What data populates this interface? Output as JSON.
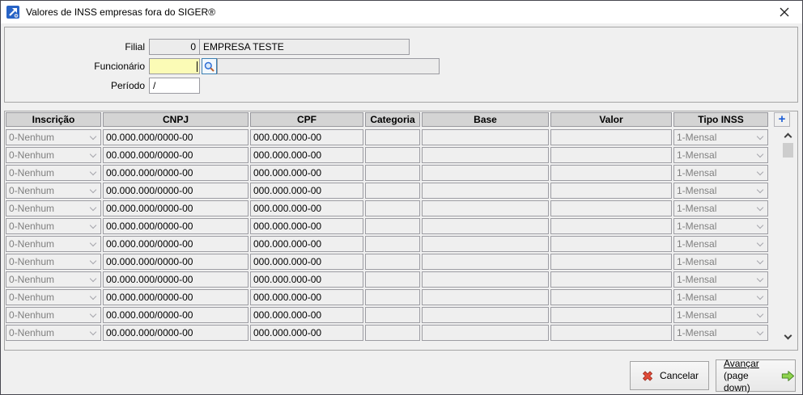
{
  "window": {
    "title": "Valores de INSS empresas fora do SIGER®"
  },
  "form": {
    "filial": {
      "label": "Filial",
      "code": "0",
      "name": "EMPRESA TESTE"
    },
    "funcionario": {
      "label": "Funcionário",
      "code": "",
      "name": ""
    },
    "periodo": {
      "label": "Período",
      "value": "/"
    }
  },
  "table": {
    "columns": [
      "Inscrição",
      "CNPJ",
      "CPF",
      "Categoria",
      "Base",
      "Valor",
      "Tipo INSS"
    ],
    "add_row_label": "+",
    "rows": [
      {
        "inscricao": "0-Nenhum",
        "cnpj": "00.000.000/0000-00",
        "cpf": "000.000.000-00",
        "categoria": "",
        "base": "",
        "valor": "",
        "tipo_inss": "1-Mensal"
      },
      {
        "inscricao": "0-Nenhum",
        "cnpj": "00.000.000/0000-00",
        "cpf": "000.000.000-00",
        "categoria": "",
        "base": "",
        "valor": "",
        "tipo_inss": "1-Mensal"
      },
      {
        "inscricao": "0-Nenhum",
        "cnpj": "00.000.000/0000-00",
        "cpf": "000.000.000-00",
        "categoria": "",
        "base": "",
        "valor": "",
        "tipo_inss": "1-Mensal"
      },
      {
        "inscricao": "0-Nenhum",
        "cnpj": "00.000.000/0000-00",
        "cpf": "000.000.000-00",
        "categoria": "",
        "base": "",
        "valor": "",
        "tipo_inss": "1-Mensal"
      },
      {
        "inscricao": "0-Nenhum",
        "cnpj": "00.000.000/0000-00",
        "cpf": "000.000.000-00",
        "categoria": "",
        "base": "",
        "valor": "",
        "tipo_inss": "1-Mensal"
      },
      {
        "inscricao": "0-Nenhum",
        "cnpj": "00.000.000/0000-00",
        "cpf": "000.000.000-00",
        "categoria": "",
        "base": "",
        "valor": "",
        "tipo_inss": "1-Mensal"
      },
      {
        "inscricao": "0-Nenhum",
        "cnpj": "00.000.000/0000-00",
        "cpf": "000.000.000-00",
        "categoria": "",
        "base": "",
        "valor": "",
        "tipo_inss": "1-Mensal"
      },
      {
        "inscricao": "0-Nenhum",
        "cnpj": "00.000.000/0000-00",
        "cpf": "000.000.000-00",
        "categoria": "",
        "base": "",
        "valor": "",
        "tipo_inss": "1-Mensal"
      },
      {
        "inscricao": "0-Nenhum",
        "cnpj": "00.000.000/0000-00",
        "cpf": "000.000.000-00",
        "categoria": "",
        "base": "",
        "valor": "",
        "tipo_inss": "1-Mensal"
      },
      {
        "inscricao": "0-Nenhum",
        "cnpj": "00.000.000/0000-00",
        "cpf": "000.000.000-00",
        "categoria": "",
        "base": "",
        "valor": "",
        "tipo_inss": "1-Mensal"
      },
      {
        "inscricao": "0-Nenhum",
        "cnpj": "00.000.000/0000-00",
        "cpf": "000.000.000-00",
        "categoria": "",
        "base": "",
        "valor": "",
        "tipo_inss": "1-Mensal"
      },
      {
        "inscricao": "0-Nenhum",
        "cnpj": "00.000.000/0000-00",
        "cpf": "000.000.000-00",
        "categoria": "",
        "base": "",
        "valor": "",
        "tipo_inss": "1-Mensal"
      }
    ]
  },
  "footer": {
    "cancel": "Cancelar",
    "advance": "Avançar",
    "advance_hint": "(page down)"
  },
  "colors": {
    "accent_blue": "#1b5cd5",
    "cancel_red": "#d8402e",
    "advance_green": "#7dc242",
    "field_yellow": "#fbfbb6",
    "header_gray": "#d4d4d4"
  }
}
